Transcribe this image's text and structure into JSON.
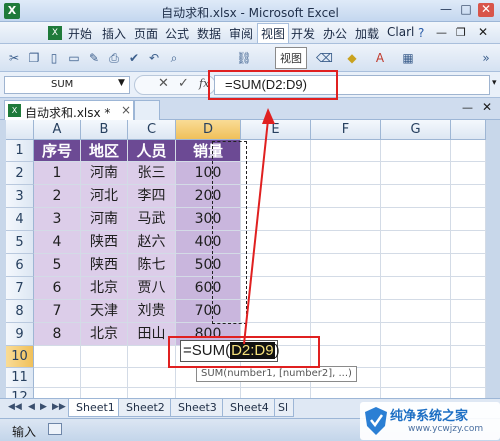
{
  "window": {
    "title": "自动求和.xlsx - Microsoft Excel",
    "logo_letter": "X",
    "minimize": "—",
    "maximize": "□",
    "close": "✕"
  },
  "menu": {
    "items": [
      "开始",
      "插入",
      "页面",
      "公式",
      "数据",
      "审阅",
      "视图",
      "开发",
      "办公",
      "加载",
      "Clarl"
    ],
    "active_index": 6
  },
  "toolbar": {
    "icons": [
      "cut-icon",
      "copy-icon",
      "new-icon",
      "open-icon",
      "brush-icon",
      "print-icon",
      "spell-icon",
      "undo-icon",
      "zoom-icon",
      "link-icon",
      "clear-icon",
      "fill-color-icon",
      "font-color-icon",
      "border-icon"
    ],
    "tooltip": "视图"
  },
  "formula_bar": {
    "name_box": "SUM",
    "cancel": "✕",
    "enter": "✓",
    "fx": "fx",
    "value": "=SUM(D2:D9)"
  },
  "workbook_tab": {
    "label": "自动求和.xlsx *",
    "close": "×"
  },
  "grid": {
    "columns": [
      "A",
      "B",
      "C",
      "D",
      "E",
      "F",
      "G"
    ],
    "selected_column": "D",
    "rows": [
      "1",
      "2",
      "3",
      "4",
      "5",
      "6",
      "7",
      "8",
      "9",
      "10",
      "11",
      "12"
    ],
    "selected_row": "10",
    "headers": [
      "序号",
      "地区",
      "人员",
      "销量"
    ],
    "data": [
      [
        "1",
        "河南",
        "张三",
        "100"
      ],
      [
        "2",
        "河北",
        "李四",
        "200"
      ],
      [
        "3",
        "河南",
        "马武",
        "300"
      ],
      [
        "4",
        "陕西",
        "赵六",
        "400"
      ],
      [
        "5",
        "陕西",
        "陈七",
        "500"
      ],
      [
        "6",
        "北京",
        "贾八",
        "600"
      ],
      [
        "7",
        "天津",
        "刘贵",
        "700"
      ],
      [
        "8",
        "北京",
        "田山",
        "800"
      ]
    ]
  },
  "edit": {
    "prefix": "=SUM(",
    "ref": "D2:D9",
    "suffix": ")",
    "hint": "SUM(number1, [number2], ...)"
  },
  "sheets": {
    "tabs": [
      "Sheet1",
      "Sheet2",
      "Sheet3",
      "Sheet4",
      "Sl"
    ],
    "active_index": 0
  },
  "status": {
    "mode": "输入"
  },
  "watermark": {
    "title": "纯净系统之家",
    "url": "www.ycwjzy.com"
  },
  "colors": {
    "header_fill": "#6c4a94",
    "data_fill": "#dccde9",
    "annotation": "#e02020"
  }
}
